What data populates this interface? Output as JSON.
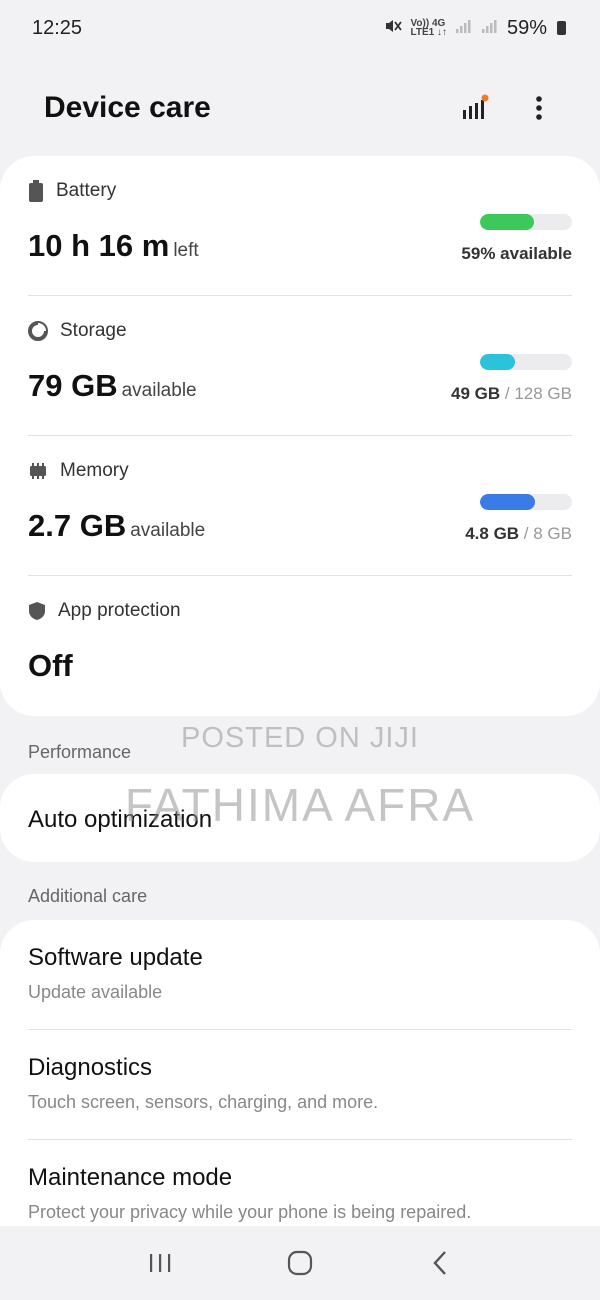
{
  "status_bar": {
    "time": "12:25",
    "volte_top": "Vo)) 4G",
    "volte_bottom": "LTE1 ↓↑",
    "battery_percent": "59%"
  },
  "header": {
    "title": "Device care",
    "icons": [
      "signal-bars-icon",
      "more-options-icon"
    ]
  },
  "status_items": [
    {
      "label": "Battery",
      "value": "10 h 16 m",
      "suffix": "left",
      "meta": "59% available",
      "fill": 0.59,
      "color": "#3cc85a",
      "icon": "battery-icon"
    },
    {
      "label": "Storage",
      "value": "79 GB",
      "suffix": "available",
      "meta_used": "49 GB",
      "meta_sep": " / ",
      "meta_total": "128 GB",
      "fill": 0.38,
      "color": "#2ac3d9",
      "icon": "storage-pie-icon"
    },
    {
      "label": "Memory",
      "value": "2.7 GB",
      "suffix": "available",
      "meta_used": "4.8 GB",
      "meta_sep": " / ",
      "meta_total": "8 GB",
      "fill": 0.6,
      "color": "#3b7be8",
      "icon": "memory-chip-icon"
    },
    {
      "label": "App protection",
      "value": "Off",
      "icon": "shield-icon"
    }
  ],
  "performance": {
    "section_label": "Performance",
    "auto_optimization": "Auto optimization"
  },
  "additional_care": {
    "section_label": "Additional care",
    "items": [
      {
        "title": "Software update",
        "subtitle": "Update available"
      },
      {
        "title": "Diagnostics",
        "subtitle": "Touch screen, sensors, charging, and more."
      },
      {
        "title": "Maintenance mode",
        "subtitle": "Protect your privacy while your phone is being repaired."
      }
    ]
  },
  "watermark": {
    "line1": "POSTED ON JIJI",
    "line2": "FATHIMA AFRA"
  },
  "nav": [
    "recent-apps-icon",
    "home-icon",
    "back-icon"
  ]
}
